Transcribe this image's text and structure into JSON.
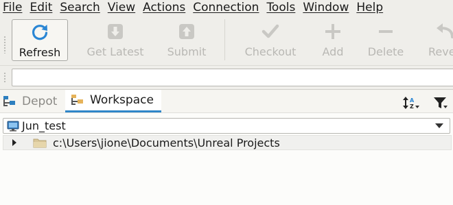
{
  "menu": [
    "File",
    "Edit",
    "Search",
    "View",
    "Actions",
    "Connection",
    "Tools",
    "Window",
    "Help"
  ],
  "toolbar": {
    "buttons": [
      {
        "label": "Refresh",
        "icon": "refresh-icon",
        "enabled": true
      },
      {
        "label": "Get Latest",
        "icon": "get-latest-icon",
        "enabled": false
      },
      {
        "label": "Submit",
        "icon": "submit-icon",
        "enabled": false
      },
      {
        "label": "Checkout",
        "icon": "checkmark-icon",
        "enabled": false
      },
      {
        "label": "Add",
        "icon": "plus-icon",
        "enabled": false
      },
      {
        "label": "Delete",
        "icon": "minus-icon",
        "enabled": false
      },
      {
        "label": "Reve",
        "icon": "revert-icon",
        "enabled": false
      }
    ]
  },
  "address": {
    "value": ""
  },
  "tabs": [
    {
      "label": "Depot",
      "icon": "depot-icon",
      "active": false
    },
    {
      "label": "Workspace",
      "icon": "workspace-icon",
      "active": true
    }
  ],
  "workspace": {
    "name": "Jun_test",
    "root_path": "c:\\Users\\jione\\Documents\\Unreal Projects"
  },
  "colors": {
    "accent": "#2f86c8",
    "refresh_blue": "#2a86d4",
    "disabled": "#c9c8c4"
  }
}
